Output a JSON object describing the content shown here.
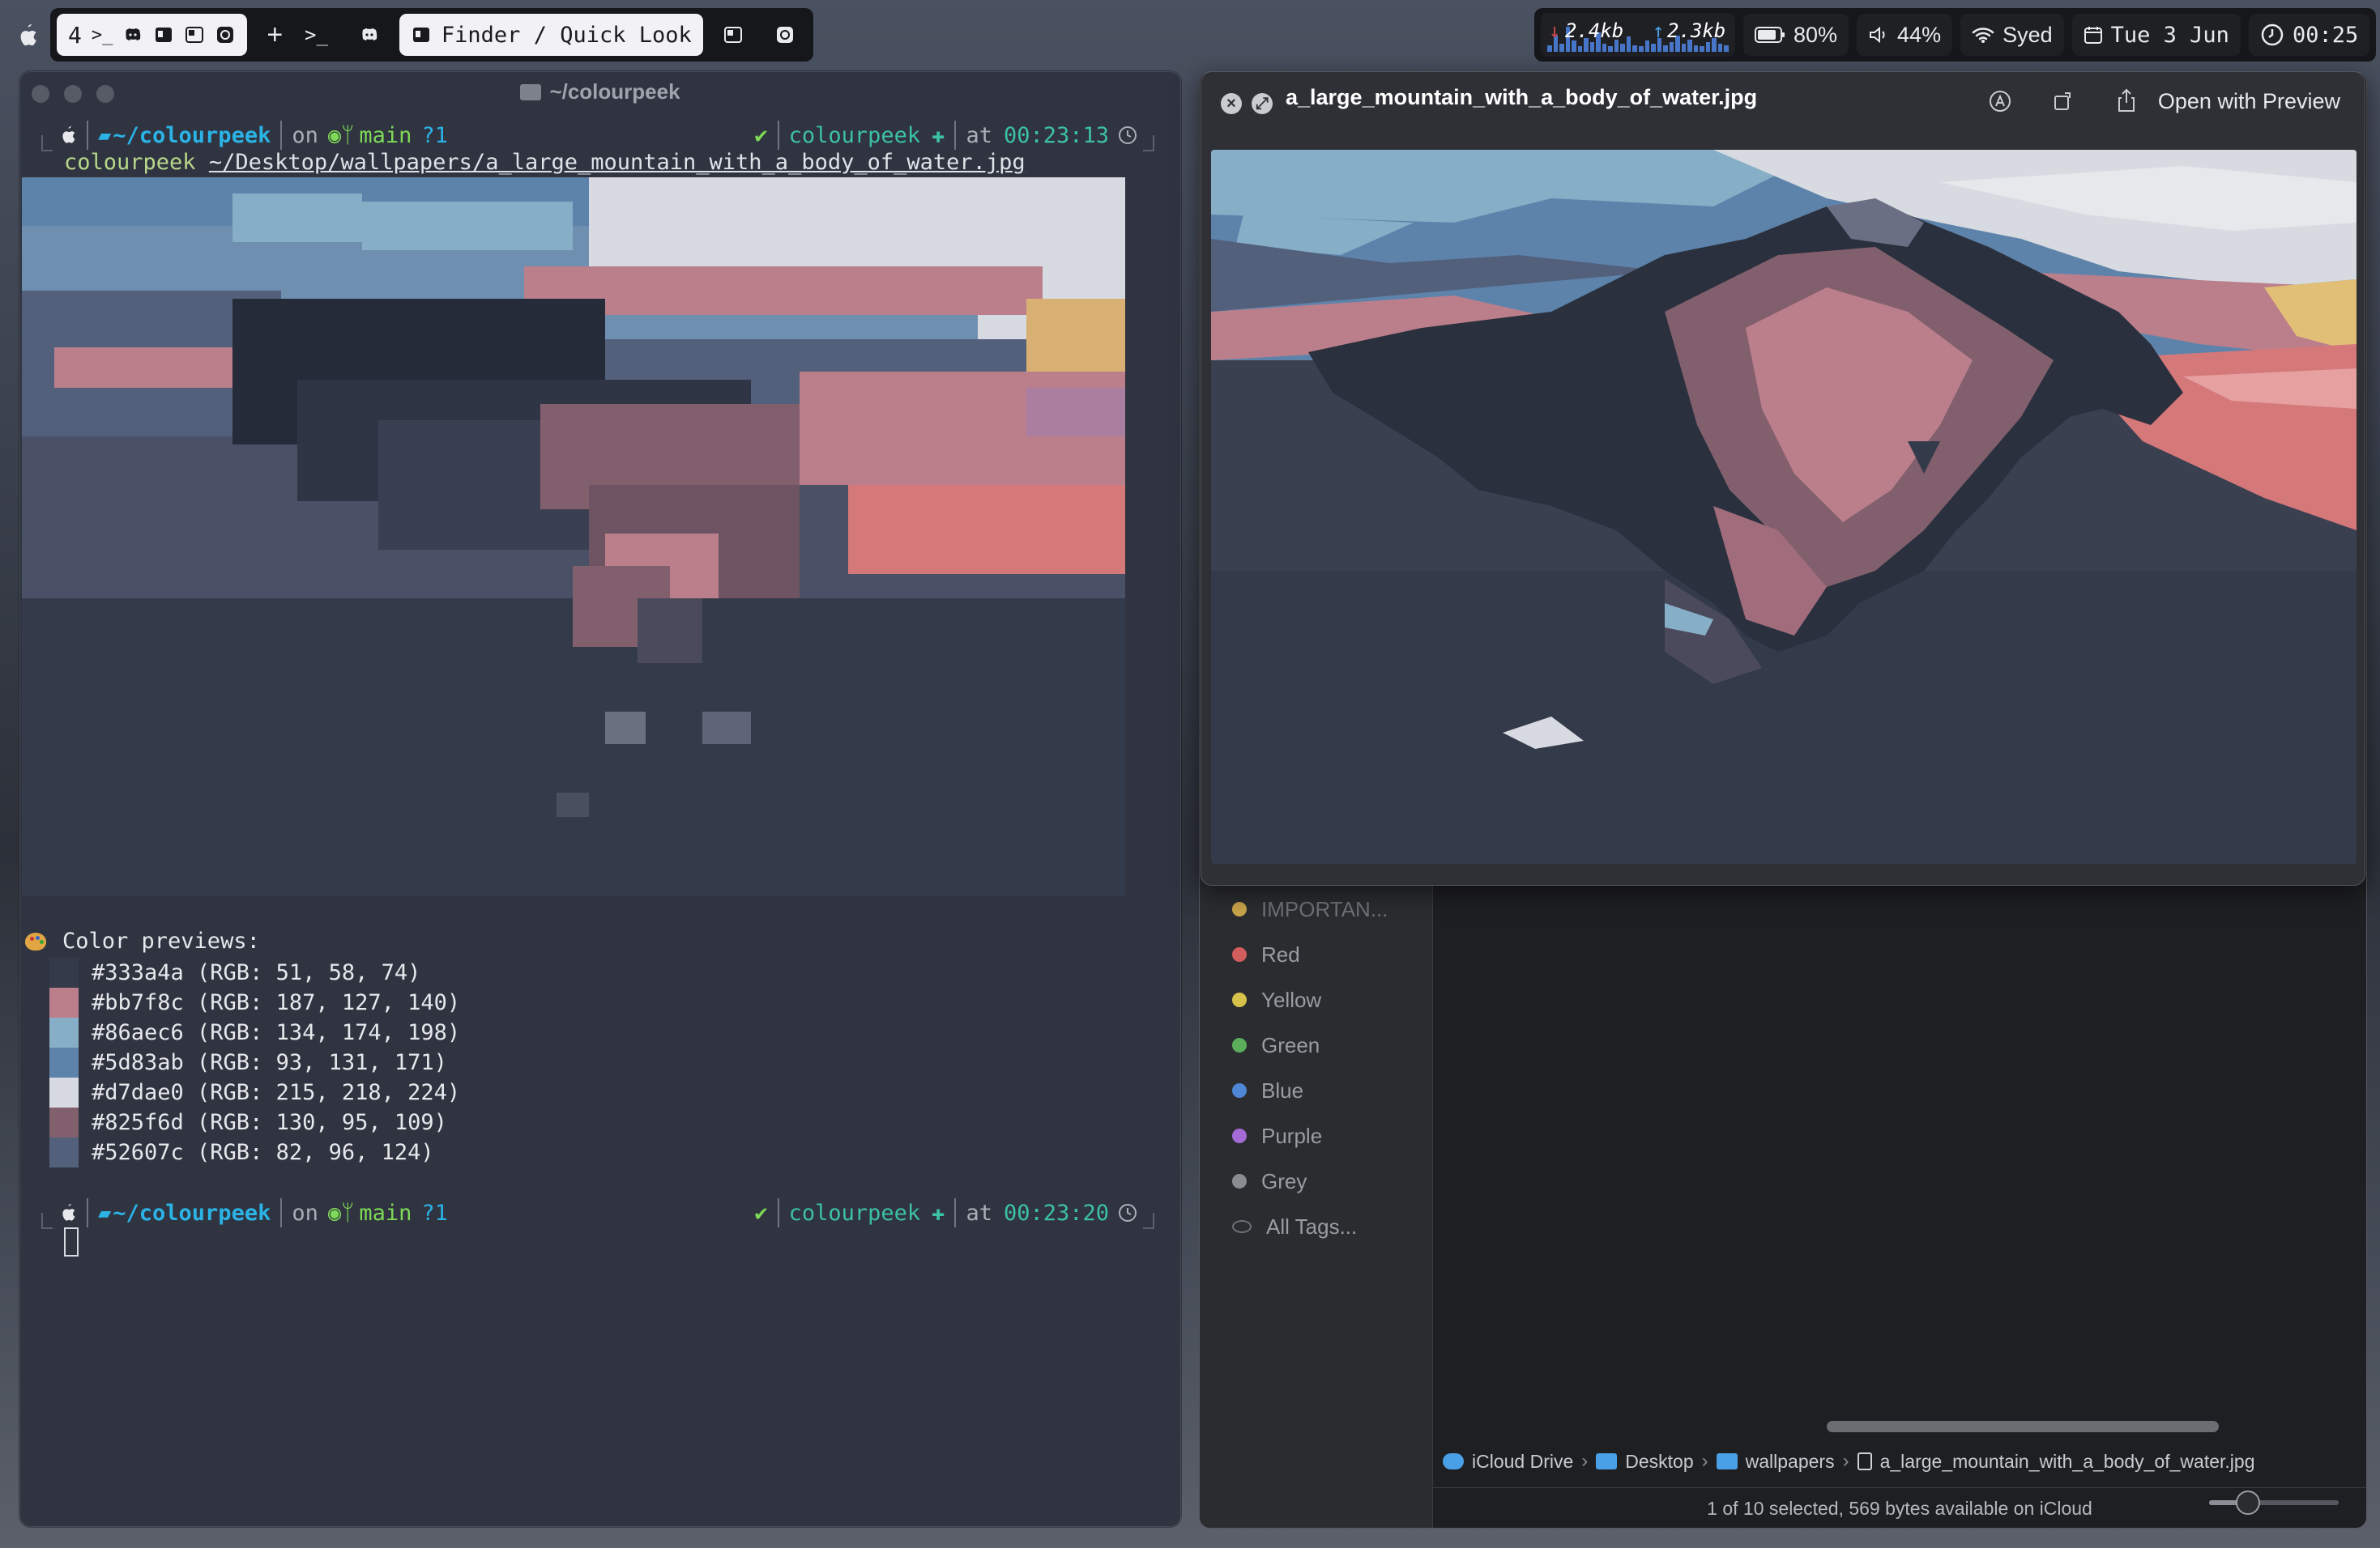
{
  "topbar": {
    "workspace_number": "4",
    "add_label": "+",
    "active_app_title": "Finder / Quick Look",
    "net_down": "2.4kb",
    "net_up": "2.3kb",
    "battery": "80%",
    "volume": "44%",
    "wifi_name": "Syed",
    "date": "Tue 3 Jun",
    "time": "00:25",
    "net_graph_levels": [
      0.25,
      0.6,
      0.3,
      0.9,
      0.4,
      0.2,
      0.5,
      0.35,
      0.7,
      0.3,
      0.2,
      0.45,
      0.3,
      0.55,
      0.25,
      0.2,
      0.4,
      0.3,
      0.5,
      0.25,
      0.35,
      0.6,
      0.3,
      0.45,
      0.25,
      0.2,
      0.35,
      0.5,
      0.3,
      0.25
    ]
  },
  "terminal": {
    "window_title": "~/colourpeek",
    "prompt1": {
      "path": "~/colourpeek",
      "on": "on",
      "branch": "main",
      "status": "?1",
      "check": "✔",
      "pkg": "colourpeek",
      "at": "at",
      "time": "00:23:13"
    },
    "command": {
      "program": "colourpeek",
      "argument": "~/Desktop/wallpapers/a_large_mountain_with_a_body_of_water.jpg"
    },
    "previews_title": "Color previews:",
    "swatches": [
      {
        "hex": "#333a4a",
        "label": "#333a4a (RGB: 51, 58, 74)"
      },
      {
        "hex": "#bb7f8c",
        "label": "#bb7f8c (RGB: 187, 127, 140)"
      },
      {
        "hex": "#86aec6",
        "label": "#86aec6 (RGB: 134, 174, 198)"
      },
      {
        "hex": "#5d83ab",
        "label": "#5d83ab (RGB: 93, 131, 171)"
      },
      {
        "hex": "#d7dae0",
        "label": "#d7dae0 (RGB: 215, 218, 224)"
      },
      {
        "hex": "#825f6d",
        "label": "#825f6d (RGB: 130, 95, 109)"
      },
      {
        "hex": "#52607c",
        "label": "#52607c (RGB: 82, 96, 124)"
      }
    ],
    "prompt2": {
      "path": "~/colourpeek",
      "on": "on",
      "branch": "main",
      "status": "?1",
      "check": "✔",
      "pkg": "colourpeek",
      "at": "at",
      "time": "00:23:20"
    }
  },
  "quicklook": {
    "filename": "a_large_mountain_with_a_body_of_water.jpg",
    "open_with": "Open with Preview"
  },
  "finder": {
    "tags": [
      {
        "label": "IMPORTAN...",
        "color": "#c8a54a"
      },
      {
        "label": "Red",
        "color": "#d35e5e"
      },
      {
        "label": "Yellow",
        "color": "#d6c14a"
      },
      {
        "label": "Green",
        "color": "#5aad5a"
      },
      {
        "label": "Blue",
        "color": "#4f86d6"
      },
      {
        "label": "Purple",
        "color": "#a46ad6"
      },
      {
        "label": "Grey",
        "color": "#8a8c92"
      },
      {
        "label": "All Tags...",
        "color": ""
      }
    ],
    "breadcrumb": [
      "iCloud Drive",
      "Desktop",
      "wallpapers",
      "a_large_mountain_with_a_body_of_water.jpg"
    ],
    "status": "1 of 10 selected, 569 bytes available on iCloud",
    "icon_size_level": 0.3
  }
}
